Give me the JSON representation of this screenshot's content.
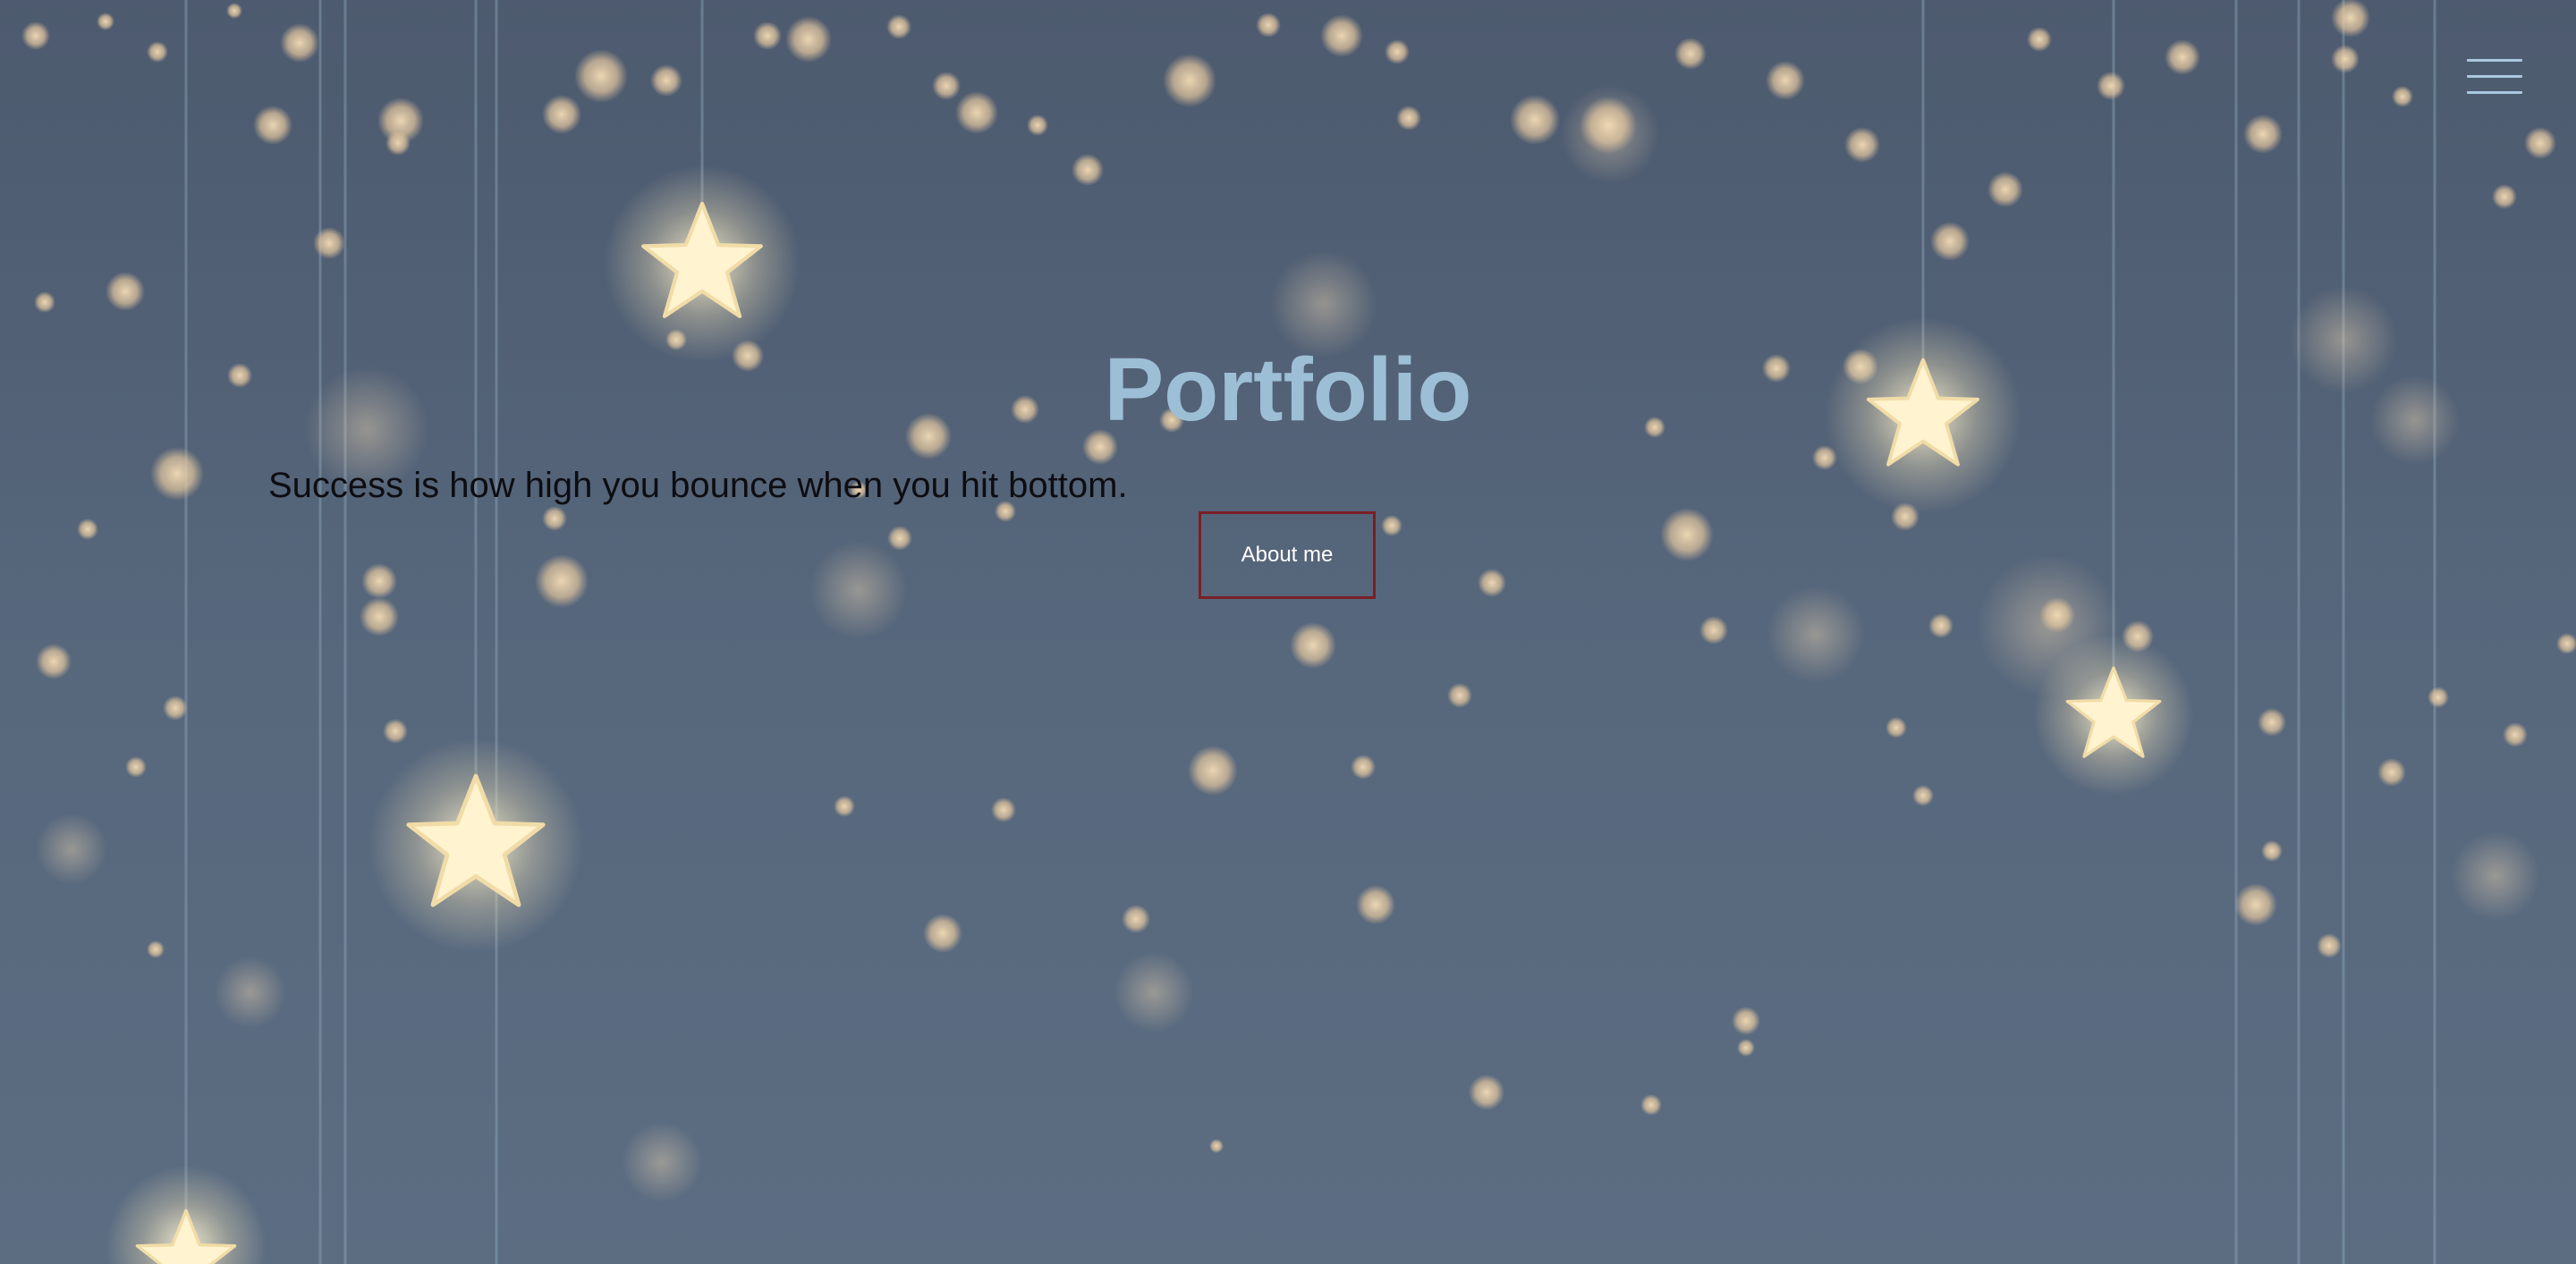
{
  "hero": {
    "title": "Portfolio",
    "tagline": "Success is how high you bounce when you hit bottom.",
    "cta_label": "About me"
  },
  "nav": {
    "menu_icon": "hamburger-menu-icon"
  },
  "background": {
    "description_icon": "hanging-stars-bokeh",
    "colors": {
      "base": "#56667b",
      "bokeh": "#e8d2b0",
      "star": "#fff6d2",
      "title": "#9dbfd6",
      "button_border": "#7a1f25"
    }
  }
}
